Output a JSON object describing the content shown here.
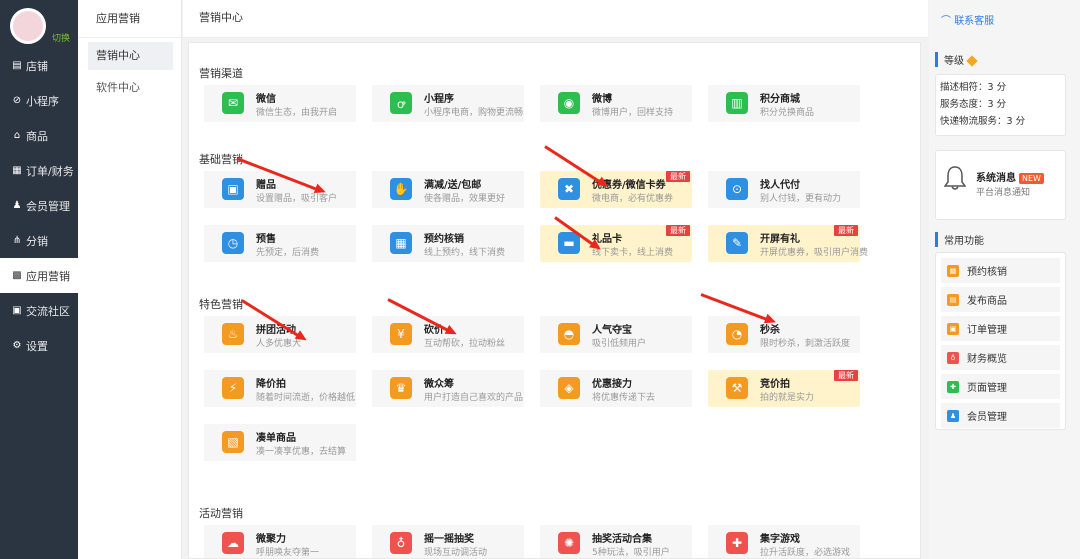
{
  "sidebar": {
    "switch_label": "切换",
    "items": [
      {
        "label": "店铺",
        "icon": "store-icon"
      },
      {
        "label": "小程序",
        "icon": "mini-program-icon"
      },
      {
        "label": "商品",
        "icon": "goods-icon"
      },
      {
        "label": "订单/财务",
        "icon": "order-icon"
      },
      {
        "label": "会员管理",
        "icon": "member-icon"
      },
      {
        "label": "分销",
        "icon": "share-icon"
      },
      {
        "label": "应用营销",
        "icon": "apps-icon",
        "active": true
      },
      {
        "label": "交流社区",
        "icon": "community-icon"
      },
      {
        "label": "设置",
        "icon": "settings-icon"
      }
    ]
  },
  "subsidebar": {
    "title": "应用营销",
    "items": [
      {
        "label": "营销中心",
        "active": true
      },
      {
        "label": "软件中心"
      }
    ]
  },
  "main": {
    "header": "营销中心",
    "sections": [
      {
        "title": "营销渠道",
        "cards": [
          {
            "name": "微信",
            "desc": "微信生态，由我开启",
            "color": "#2dbe4f",
            "icon": "wechat-icon"
          },
          {
            "name": "小程序",
            "desc": "小程序电商，购物更流畅",
            "color": "#2dbe4f",
            "icon": "mini-program-icon"
          },
          {
            "name": "微博",
            "desc": "微博用户，回样支持",
            "color": "#2dbe4f",
            "icon": "weibo-icon"
          },
          {
            "name": "积分商城",
            "desc": "积分兑换商品",
            "color": "#2dbe4f",
            "icon": "points-mall-icon"
          }
        ]
      },
      {
        "title": "基础营销",
        "cards": [
          {
            "name": "赠品",
            "desc": "设置赠品，吸引客户",
            "color": "#2f8fe0",
            "icon": "gift-box-icon"
          },
          {
            "name": "满减/送/包邮",
            "desc": "使各赠品，效果更好",
            "color": "#2f8fe0",
            "icon": "discount-icon"
          },
          {
            "name": "优惠券/微信卡券",
            "desc": "微电商，必有优惠券",
            "color": "#2f8fe0",
            "icon": "coupon-icon",
            "badge": "最新",
            "highlight": true
          },
          {
            "name": "找人代付",
            "desc": "别人付钱，更有动力",
            "color": "#2f8fe0",
            "icon": "pay-for-me-icon"
          },
          {
            "name": "预售",
            "desc": "先预定，后消费",
            "color": "#2f8fe0",
            "icon": "presale-icon"
          },
          {
            "name": "预约核销",
            "desc": "线上预约，线下消费",
            "color": "#2f8fe0",
            "icon": "reservation-icon"
          },
          {
            "name": "礼品卡",
            "desc": "线下卖卡，线上消费",
            "color": "#2f8fe0",
            "icon": "gift-card-icon",
            "badge": "最新",
            "highlight": true
          },
          {
            "name": "开屏有礼",
            "desc": "开屏优惠券，吸引用户消费",
            "color": "#2f8fe0",
            "icon": "splash-gift-icon",
            "badge": "最新",
            "highlight": true
          }
        ]
      },
      {
        "title": "特色营销",
        "cards": [
          {
            "name": "拼团活动",
            "desc": "人多优惠大",
            "color": "#f39a23",
            "icon": "group-buy-icon"
          },
          {
            "name": "砍价",
            "desc": "互动帮砍，拉动粉丝",
            "color": "#f39a23",
            "icon": "bargain-icon"
          },
          {
            "name": "人气夺宝",
            "desc": "吸引低频用户",
            "color": "#f39a23",
            "icon": "treasure-icon"
          },
          {
            "name": "秒杀",
            "desc": "限时秒杀，刺激活跃度",
            "color": "#f39a23",
            "icon": "flash-sale-icon"
          },
          {
            "name": "降价拍",
            "desc": "随着时间流逝，价格越低",
            "color": "#f39a23",
            "icon": "price-drop-icon"
          },
          {
            "name": "微众筹",
            "desc": "用户打造自己喜欢的产品",
            "color": "#f39a23",
            "icon": "crowdfunding-icon"
          },
          {
            "name": "优惠接力",
            "desc": "将优惠传递下去",
            "color": "#f39a23",
            "icon": "relay-icon"
          },
          {
            "name": "竞价拍",
            "desc": "拍的就是实力",
            "color": "#f39a23",
            "icon": "auction-icon",
            "badge": "最新",
            "highlight": true
          },
          {
            "name": "凑单商品",
            "desc": "凑一凑享优惠，去结算",
            "color": "#f39a23",
            "icon": "basket-icon"
          }
        ]
      },
      {
        "title": "活动营销",
        "cards": [
          {
            "name": "微聚力",
            "desc": "呼朋唤友夺第一",
            "color": "#ef5350",
            "icon": "gather-icon"
          },
          {
            "name": "摇一摇抽奖",
            "desc": "现场互动调活动",
            "color": "#ef5350",
            "icon": "shake-lottery-icon"
          },
          {
            "name": "抽奖活动合集",
            "desc": "5种玩法，吸引用户",
            "color": "#ef5350",
            "icon": "lottery-set-icon"
          },
          {
            "name": "集字游戏",
            "desc": "拉升活跃度，必选游戏",
            "color": "#ef5350",
            "icon": "word-game-icon"
          }
        ]
      }
    ]
  },
  "right": {
    "contact": "联系客服",
    "level_title": "等级",
    "scores": [
      {
        "label": "描述相符：",
        "value": "3 分"
      },
      {
        "label": "服务态度：",
        "value": "3 分"
      },
      {
        "label": "快递物流服务：",
        "value": "3 分"
      }
    ],
    "message": {
      "title": "系统消息",
      "badge": "NEW",
      "subtitle": "平台消息通知"
    },
    "common_title": "常用功能",
    "common": [
      {
        "label": "预约核销",
        "color": "#f39a23"
      },
      {
        "label": "发布商品",
        "color": "#f39a23"
      },
      {
        "label": "订单管理",
        "color": "#f39a23"
      },
      {
        "label": "财务概览",
        "color": "#ef5350"
      },
      {
        "label": "页面管理",
        "color": "#2dbe4f"
      },
      {
        "label": "会员管理",
        "color": "#2f8fe0"
      }
    ]
  }
}
